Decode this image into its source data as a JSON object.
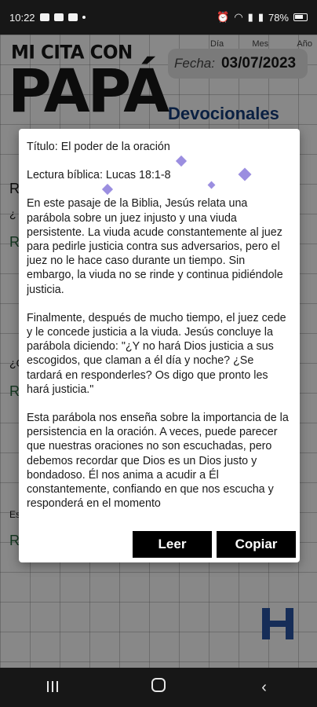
{
  "status_bar": {
    "time": "10:22",
    "battery": "78%"
  },
  "background": {
    "logo_small": "MI CITA CON",
    "logo_big": "PAPÁ",
    "date_heads": [
      "Día",
      "Mes",
      "Año"
    ],
    "date_label": "Fecha:",
    "date_value": "03/07/2023",
    "devotionals_title": "Devocionales",
    "left_fragments": [
      "R",
      "¿",
      "R",
      "¿C",
      "R",
      "Es",
      "R"
    ]
  },
  "dialog": {
    "title_line": "Título: El poder de la oración",
    "reading_line": "Lectura bíblica: Lucas 18:1-8",
    "paragraphs": [
      "En este pasaje de la Biblia, Jesús relata una parábola sobre un juez injusto y una viuda persistente. La viuda acude constantemente al juez para pedirle justicia contra sus adversarios, pero el juez no le hace caso durante un tiempo. Sin embargo, la viuda no se rinde y continua pidiéndole justicia.",
      "Finalmente, después de mucho tiempo, el juez cede y le concede justicia a la viuda. Jesús concluye la parábola diciendo: \"¿Y no hará Dios justicia a sus escogidos, que claman a él día y noche? ¿Se tardará en responderles? Os digo que pronto les hará justicia.\"",
      "Esta parábola nos enseña sobre la importancia de la persistencia en la oración. A veces, puede parecer que nuestras oraciones no son escuchadas, pero debemos recordar que Dios es un Dios justo y bondadoso. Él nos anima a acudir a Él constantemente, confiando en que nos escucha y responderá en el momento"
    ],
    "buttons": {
      "read": "Leer",
      "copy": "Copiar"
    }
  }
}
